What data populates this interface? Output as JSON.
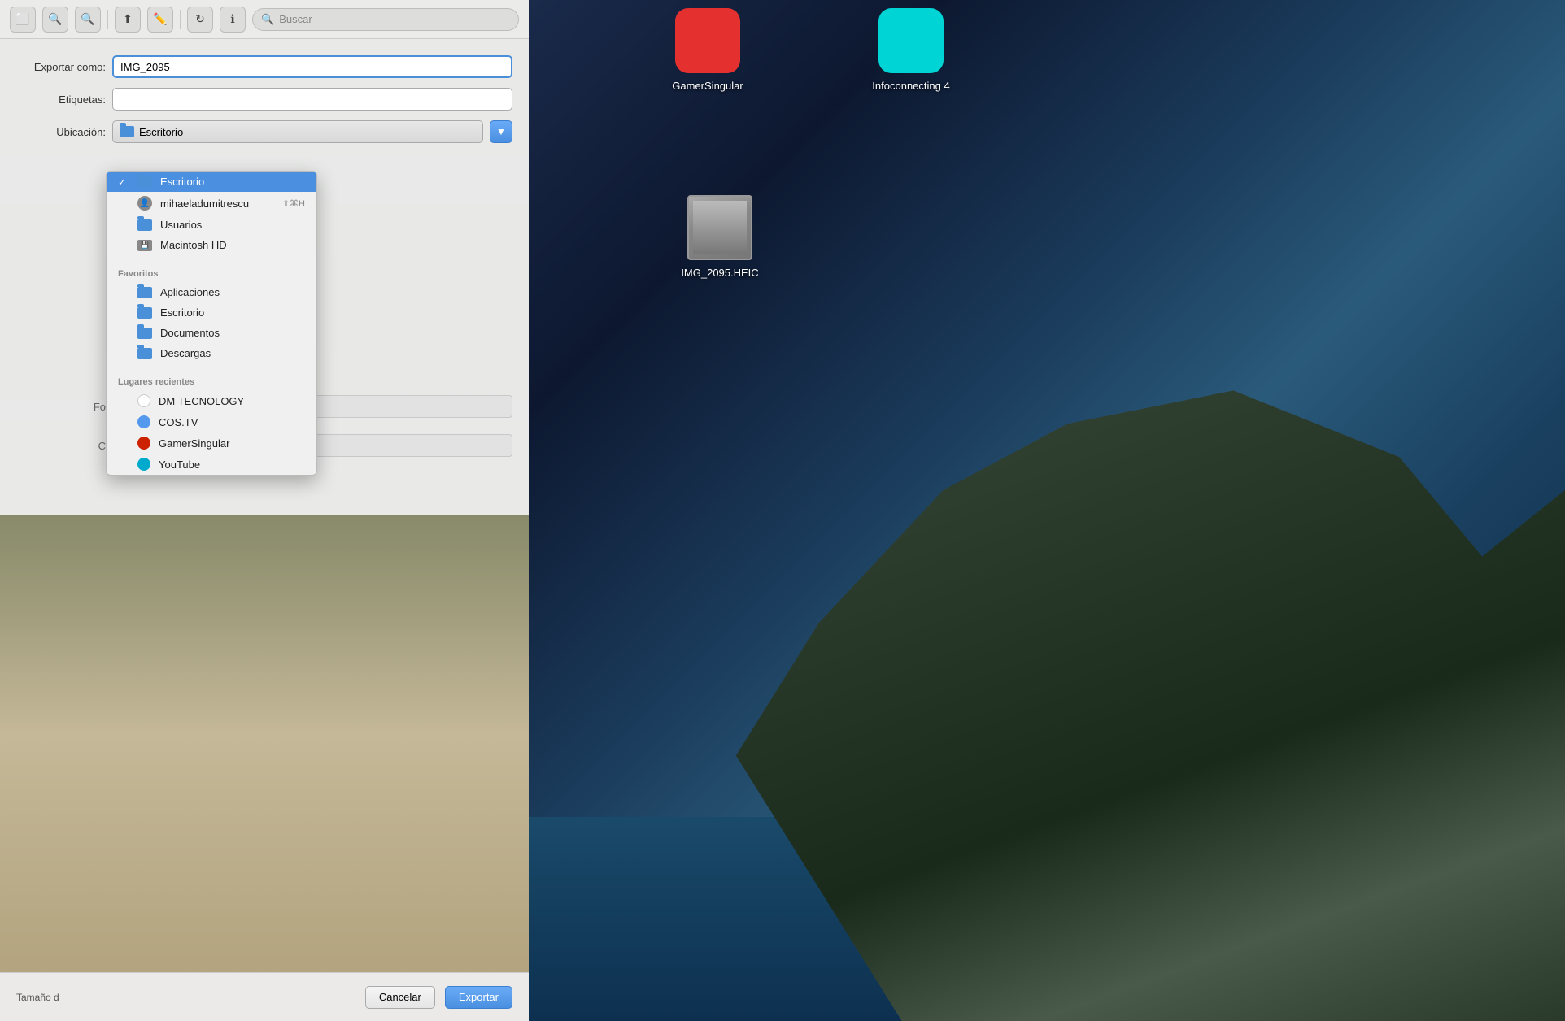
{
  "toolbar": {
    "search_placeholder": "Buscar"
  },
  "dialog": {
    "export_label": "Exportar como:",
    "export_value": "IMG_2095",
    "tags_label": "Etiquetas:",
    "location_label": "Ubicación:",
    "location_selected": "Escritorio",
    "tamaño_label": "Tamaño d",
    "cancel_label": "Cancelar",
    "export_btn_label": "Exportar"
  },
  "dropdown": {
    "top_items": [
      {
        "id": "escritorio",
        "label": "Escritorio",
        "type": "folder",
        "selected": true,
        "shortcut": ""
      },
      {
        "id": "mihaeladumitrescu",
        "label": "mihaeladumitrescu",
        "type": "user",
        "selected": false,
        "shortcut": "⇧⌘H"
      },
      {
        "id": "usuarios",
        "label": "Usuarios",
        "type": "folder",
        "selected": false,
        "shortcut": ""
      },
      {
        "id": "macintosh_hd",
        "label": "Macintosh HD",
        "type": "hd",
        "selected": false,
        "shortcut": ""
      }
    ],
    "favoritos_header": "Favoritos",
    "favoritos": [
      {
        "id": "aplicaciones",
        "label": "Aplicaciones",
        "type": "folder"
      },
      {
        "id": "escritorio2",
        "label": "Escritorio",
        "type": "folder"
      },
      {
        "id": "documentos",
        "label": "Documentos",
        "type": "folder"
      },
      {
        "id": "descargas",
        "label": "Descargas",
        "type": "folder"
      }
    ],
    "lugares_header": "Lugares recientes",
    "lugares": [
      {
        "id": "dm_tecnology",
        "label": "DM TECNOLOGY",
        "type": "circle-white"
      },
      {
        "id": "cos_tv",
        "label": "COS.TV",
        "type": "circle-blue-light"
      },
      {
        "id": "gamersingular",
        "label": "GamerSingular",
        "type": "circle-red"
      },
      {
        "id": "youtube",
        "label": "YouTube",
        "type": "circle-cyan"
      }
    ]
  },
  "desktop_icons": {
    "gamer_singular": {
      "label": "GamerSingular",
      "color": "#e53030"
    },
    "infoconnecting": {
      "label": "Infoconnecting 4",
      "color": "#00d4d4"
    },
    "img_file": {
      "label": "IMG_2095.HEIC"
    }
  }
}
